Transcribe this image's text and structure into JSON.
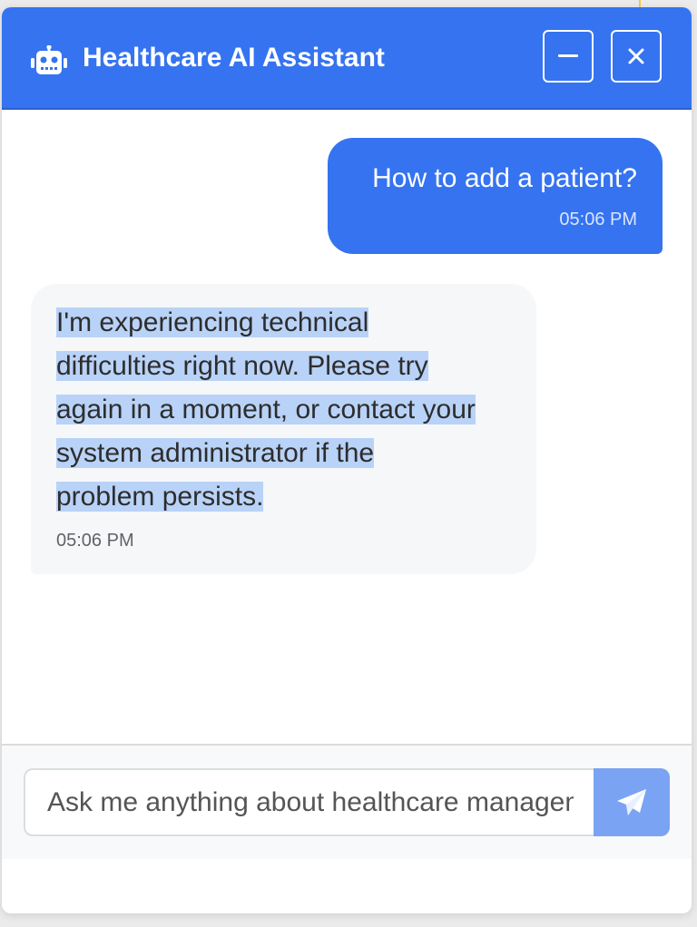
{
  "header": {
    "title": "Healthcare AI Assistant",
    "bot_icon": "robot-icon",
    "minimize_icon": "minus-icon",
    "close_icon": "close-icon"
  },
  "messages": [
    {
      "role": "user",
      "text": "How to add a patient?",
      "time": "05:06 PM"
    },
    {
      "role": "assistant",
      "text_lines": [
        "I'm experiencing technical",
        "difficulties right now. Please try",
        "again in a moment, or contact your",
        "system administrator if the",
        "problem persists."
      ],
      "time": "05:06 PM",
      "selected": true
    }
  ],
  "composer": {
    "placeholder": "Ask me anything about healthcare management...",
    "send_icon": "paper-plane-icon"
  },
  "colors": {
    "primary": "#3573f0",
    "send_button": "#7aa3f3",
    "selection": "#b9d2f7",
    "bot_bubble": "#f6f7f9"
  }
}
